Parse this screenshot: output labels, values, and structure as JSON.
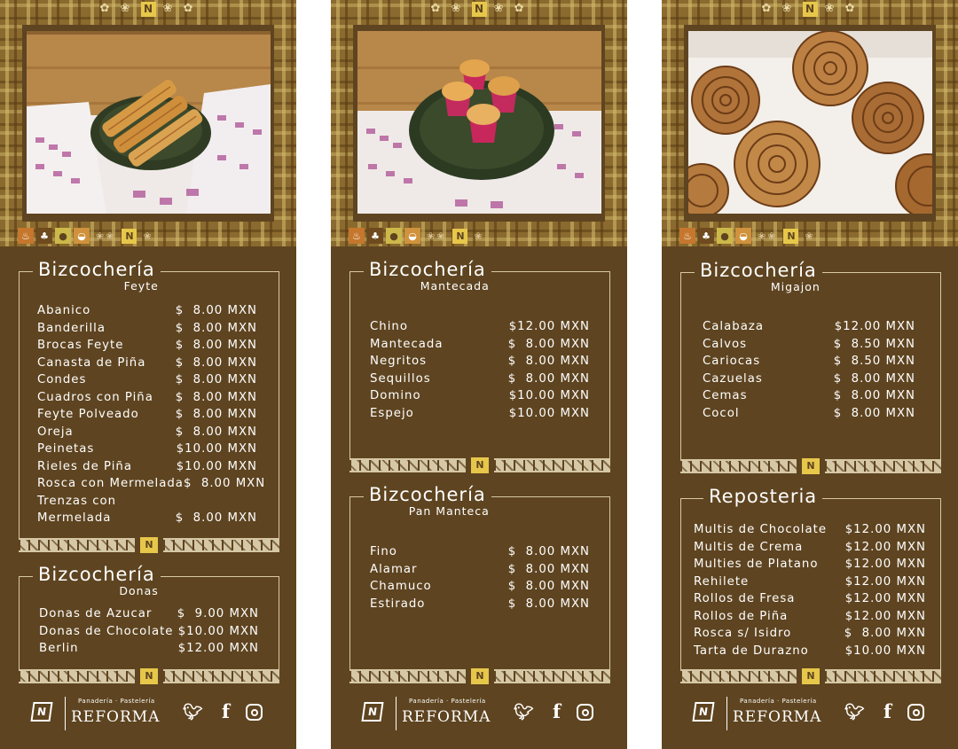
{
  "brand": {
    "tagline": "Panadería · Pastelería",
    "name": "REFORMA",
    "logo_icon": "reforma-logo-icon",
    "social": [
      "twitter-icon",
      "facebook-icon",
      "instagram-icon"
    ]
  },
  "colors": {
    "background": "#5e4420",
    "border_pattern": "#8a6a2e",
    "accent_yellow": "#e7c74a",
    "frame_line": "#d9c9a4",
    "text": "#ffffff"
  },
  "panels": [
    {
      "photo": "puff-pastry-sticks-photo",
      "sections": [
        {
          "title": "Bizcochería",
          "subtitle": "Feyte",
          "items": [
            {
              "name": "Abanico",
              "price": "$  8.00 MXN"
            },
            {
              "name": "Banderilla",
              "price": "$  8.00 MXN"
            },
            {
              "name": "Brocas Feyte",
              "price": "$  8.00 MXN"
            },
            {
              "name": "Canasta de Piña",
              "price": "$  8.00 MXN"
            },
            {
              "name": "Condes",
              "price": "$  8.00 MXN"
            },
            {
              "name": "Cuadros con Piña",
              "price": "$  8.00 MXN"
            },
            {
              "name": "Feyte Polveado",
              "price": "$  8.00 MXN"
            },
            {
              "name": "Oreja",
              "price": "$  8.00 MXN"
            },
            {
              "name": "Peinetas",
              "price": "$10.00 MXN"
            },
            {
              "name": "Rieles de Piña",
              "price": "$10.00 MXN"
            },
            {
              "name": "Rosca con Mermelada",
              "price": "$  8.00 MXN"
            },
            {
              "name": "Trenzas con",
              "price": ""
            },
            {
              "name": "Mermelada",
              "price": "$  8.00 MXN"
            }
          ]
        },
        {
          "title": "Bizcochería",
          "subtitle": "Donas",
          "items": [
            {
              "name": "Donas de Azucar",
              "price": "$  9.00 MXN"
            },
            {
              "name": "Donas de Chocolate",
              "price": "$10.00 MXN"
            },
            {
              "name": "Berlin",
              "price": "$12.00 MXN"
            }
          ]
        }
      ]
    },
    {
      "photo": "mantecada-muffins-photo",
      "sections": [
        {
          "title": "Bizcochería",
          "subtitle": "Mantecada",
          "items": [
            {
              "name": "Chino",
              "price": "$12.00 MXN"
            },
            {
              "name": "Mantecada",
              "price": "$  8.00 MXN"
            },
            {
              "name": "Negritos",
              "price": "$  8.00 MXN"
            },
            {
              "name": "Sequillos",
              "price": "$  8.00 MXN"
            },
            {
              "name": "Domino",
              "price": "$10.00 MXN"
            },
            {
              "name": "Espejo",
              "price": "$10.00 MXN"
            }
          ]
        },
        {
          "title": "Bizcochería",
          "subtitle": "Pan Manteca",
          "items": [
            {
              "name": "Fino",
              "price": "$  8.00 MXN"
            },
            {
              "name": "Alamar",
              "price": "$  8.00 MXN"
            },
            {
              "name": "Chamuco",
              "price": "$  8.00 MXN"
            },
            {
              "name": "Estirado",
              "price": "$  8.00 MXN"
            }
          ]
        }
      ]
    },
    {
      "photo": "cinnamon-rolls-photo",
      "sections": [
        {
          "title": "Bizcochería",
          "subtitle": "Migajon",
          "items": [
            {
              "name": "Calabaza",
              "price": "$12.00 MXN"
            },
            {
              "name": "Calvos",
              "price": "$  8.50 MXN"
            },
            {
              "name": "Cariocas",
              "price": "$  8.50 MXN"
            },
            {
              "name": "Cazuelas",
              "price": "$  8.00 MXN"
            },
            {
              "name": "Cemas",
              "price": "$  8.00 MXN"
            },
            {
              "name": "Cocol",
              "price": "$  8.00 MXN"
            }
          ]
        },
        {
          "title": "Reposteria",
          "subtitle": "",
          "items": [
            {
              "name": "Multis de Chocolate",
              "price": "$12.00 MXN"
            },
            {
              "name": "Multis de Crema",
              "price": "$12.00 MXN"
            },
            {
              "name": "Multies de Platano",
              "price": "$12.00 MXN"
            },
            {
              "name": "Rehilete",
              "price": "$12.00 MXN"
            },
            {
              "name": "Rollos de Fresa",
              "price": "$12.00 MXN"
            },
            {
              "name": "Rollos de Piña",
              "price": "$12.00 MXN"
            },
            {
              "name": "Rosca s/ Isidro",
              "price": "$  8.00 MXN"
            },
            {
              "name": "Tarta de Durazno",
              "price": "$10.00 MXN"
            }
          ]
        }
      ]
    }
  ]
}
